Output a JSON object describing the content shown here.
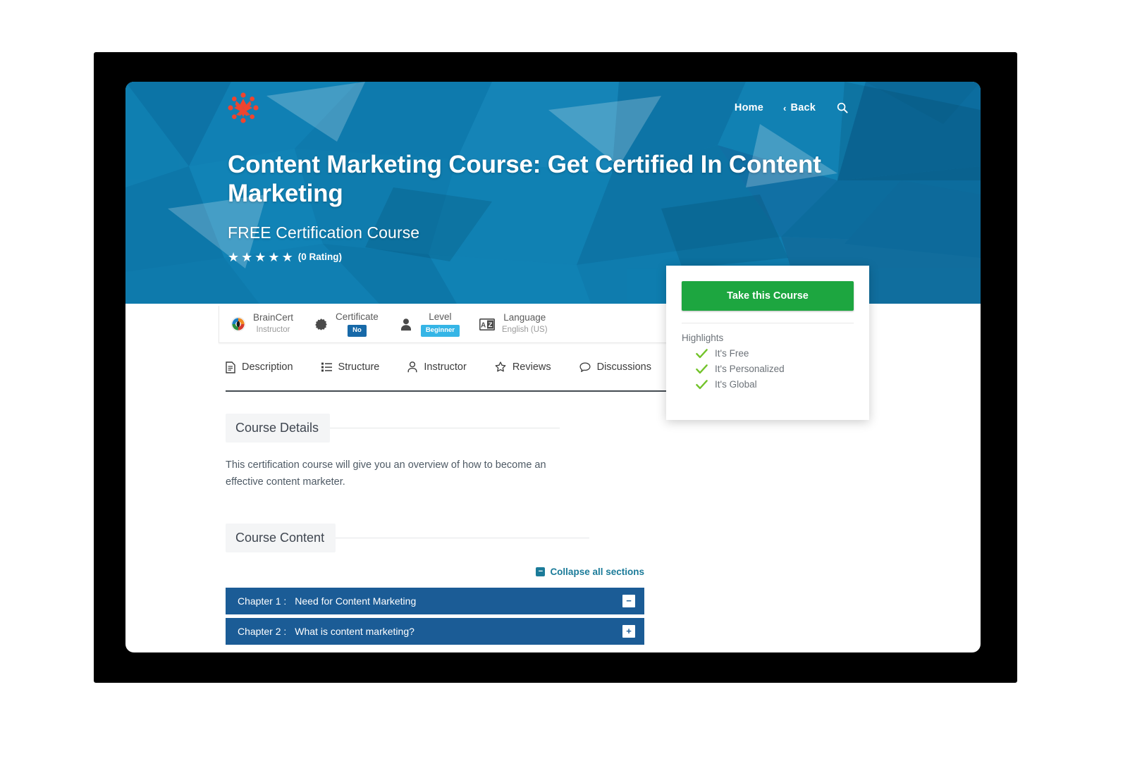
{
  "brand": {
    "logo_icon": "braincert-starburst-logo",
    "accent": "#f0442e"
  },
  "nav": {
    "home_label": "Home",
    "back_label": "Back",
    "back_chevron": "‹",
    "search_icon": "search-icon"
  },
  "hero": {
    "title": "Content Marketing Course: Get Certified In Content Marketing",
    "subtitle": "FREE Certification Course",
    "rating_stars": 5,
    "rating_text": "(0 Rating)",
    "bg_color": "#0f7cb0"
  },
  "info_bar": [
    {
      "icon": "instructor-avatar",
      "label": "BrainCert",
      "value": "Instructor",
      "badge": null
    },
    {
      "icon": "certificate-icon",
      "label": "Certificate",
      "value": null,
      "badge": "No",
      "badge_color": "#1769a8"
    },
    {
      "icon": "level-icon",
      "label": "Level",
      "value": null,
      "badge": "Beginner",
      "badge_color": "#35b5e6"
    },
    {
      "icon": "language-icon",
      "label": "Language",
      "value": "English (US)",
      "badge": null
    }
  ],
  "tabs": [
    {
      "label": "Description",
      "icon": "document-icon",
      "active": true
    },
    {
      "label": "Structure",
      "icon": "list-icon",
      "active": false
    },
    {
      "label": "Instructor",
      "icon": "person-icon",
      "active": false
    },
    {
      "label": "Reviews",
      "icon": "star-outline-icon",
      "active": false
    },
    {
      "label": "Discussions",
      "icon": "chat-bubble-icon",
      "active": false
    }
  ],
  "sections": {
    "details_heading": "Course Details",
    "details_text": "This certification course will give you an overview of how to become an effective content marketer.",
    "content_heading": "Course Content",
    "collapse_label": "Collapse all sections",
    "collapse_toggle_glyph": "−"
  },
  "chapters": [
    {
      "number": "Chapter 1 :",
      "title": "Need for Content Marketing",
      "toggle": "−",
      "expanded": true
    },
    {
      "number": "Chapter 2 :",
      "title": "What is content marketing?",
      "toggle": "+",
      "expanded": false
    }
  ],
  "course_card": {
    "cta_label": "Take this Course",
    "cta_color": "#1da640",
    "highlights_label": "Highlights",
    "highlights": [
      "It's Free",
      "It's Personalized",
      "It's Global"
    ],
    "check_color": "#72c32a"
  }
}
